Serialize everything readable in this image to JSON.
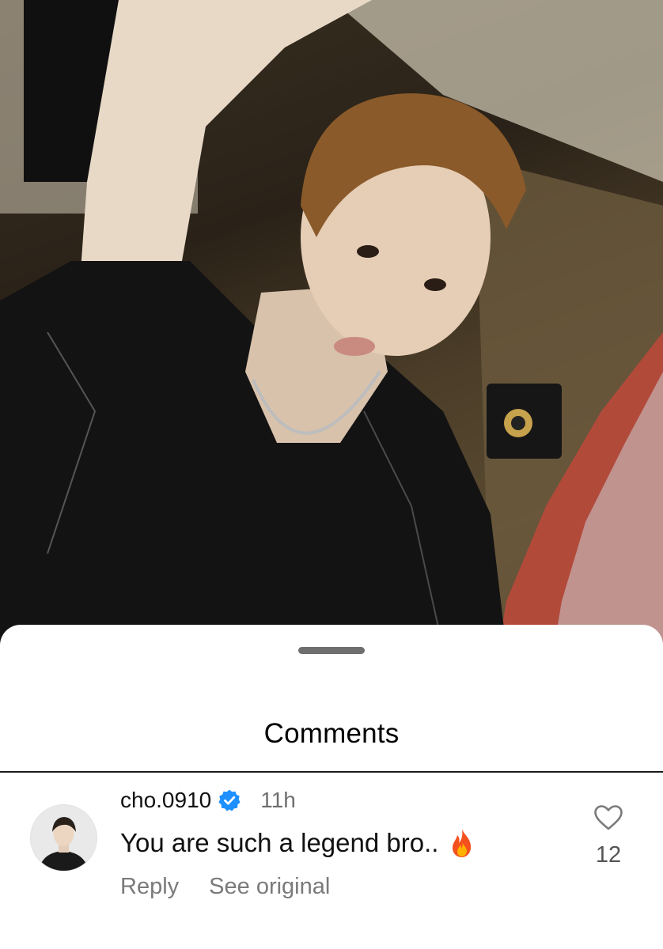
{
  "post": {
    "image": "photo-background"
  },
  "sheet": {
    "title": "Comments"
  },
  "comment": {
    "username": "cho.0910",
    "verified": true,
    "timestamp": "11h",
    "text": "You are such a legend bro..",
    "emoji_icon": "fire-emoji-icon",
    "like_count": "12",
    "actions": {
      "reply": "Reply",
      "see_original": "See original"
    }
  },
  "colors": {
    "verified_blue": "#1e90ff",
    "secondary_text": "#7a7a7a",
    "sheet_background": "#ffffff"
  }
}
